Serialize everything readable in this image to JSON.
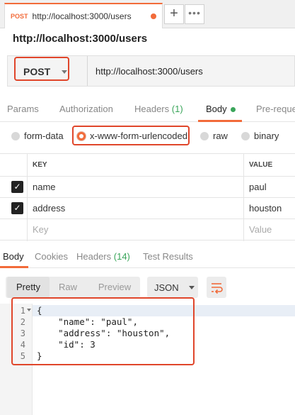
{
  "tab": {
    "method": "POST",
    "url": "http://localhost:3000/users"
  },
  "toolbar": {
    "plus": "+",
    "more": "•••"
  },
  "request": {
    "title": "http://localhost:3000/users",
    "method": "POST",
    "url": "http://localhost:3000/users"
  },
  "request_tabs": {
    "params": "Params",
    "authorization": "Authorization",
    "headers": "Headers",
    "headers_count": "(1)",
    "body": "Body",
    "pre_request": "Pre-reque"
  },
  "body_types": {
    "form_data": "form-data",
    "urlencoded": "x-www-form-urlencoded",
    "raw": "raw",
    "binary": "binary",
    "selected": "x-www-form-urlencoded"
  },
  "kv_table": {
    "headers": {
      "key": "KEY",
      "value": "VALUE"
    },
    "rows": [
      {
        "checked": true,
        "key": "name",
        "value": "paul"
      },
      {
        "checked": true,
        "key": "address",
        "value": "houston"
      }
    ],
    "placeholder": {
      "key": "Key",
      "value": "Value"
    }
  },
  "response_tabs": {
    "body": "Body",
    "cookies": "Cookies",
    "headers": "Headers",
    "headers_count": "(14)",
    "test_results": "Test Results"
  },
  "response_toolbar": {
    "pretty": "Pretty",
    "raw": "Raw",
    "preview": "Preview",
    "format": "JSON"
  },
  "response_body": {
    "line_numbers": [
      "1",
      "2",
      "3",
      "4",
      "5"
    ],
    "lines": [
      "{",
      "    \"name\": \"paul\",",
      "    \"address\": \"houston\",",
      "    \"id\": 3",
      "}"
    ]
  },
  "colors": {
    "accent": "#f26b3a",
    "highlight": "#e0462b",
    "success": "#3aa55a"
  }
}
